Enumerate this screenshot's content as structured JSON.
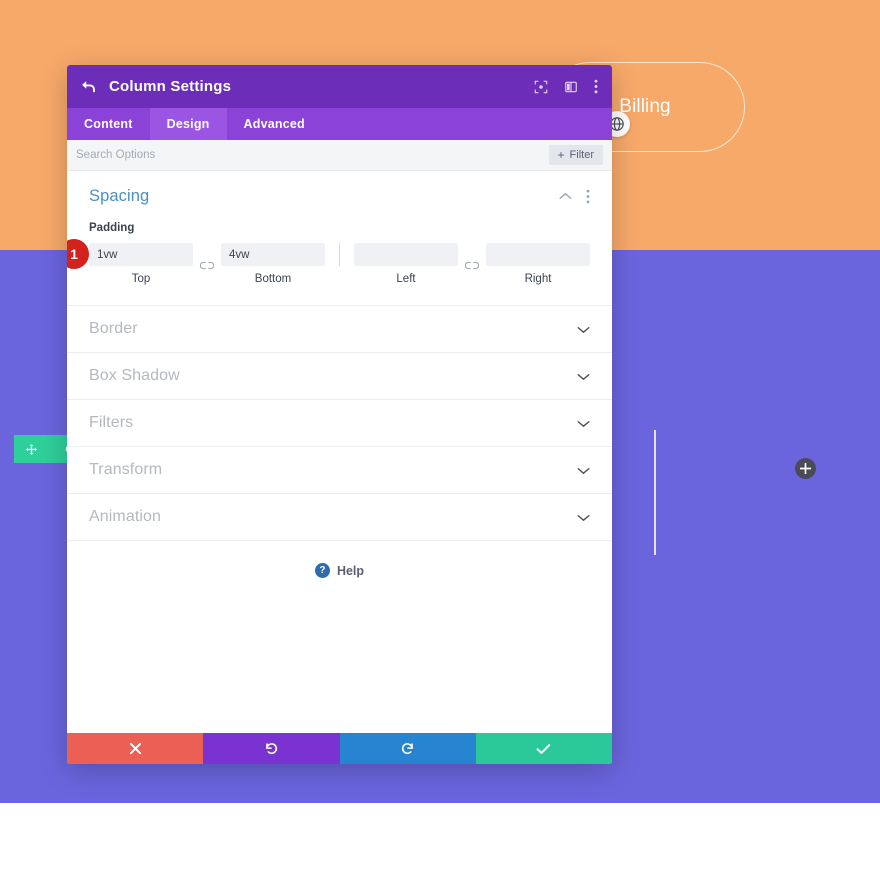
{
  "page_background": {
    "hero_color": "#f7a96a",
    "band_color": "#6a65dd",
    "bottom_color": "#ffffff",
    "hero_pill_label": "Billing",
    "hero_badge_icon": "globe-icon",
    "add_module_icon": "plus-icon",
    "module_toolbar": {
      "move_icon": "move-icon",
      "settings_icon": "gear-icon"
    }
  },
  "modal": {
    "header": {
      "back_icon": "back-arrow-icon",
      "title": "Column Settings",
      "icons": [
        {
          "name": "fullscreen-icon"
        },
        {
          "name": "split-view-icon"
        },
        {
          "name": "more-options-icon"
        }
      ]
    },
    "tabs": [
      {
        "label": "Content",
        "active": false
      },
      {
        "label": "Design",
        "active": true
      },
      {
        "label": "Advanced",
        "active": false
      }
    ],
    "search": {
      "value": "",
      "placeholder": "Search Options"
    },
    "filter_button": {
      "label": "Filter",
      "plus": "+"
    },
    "spacing": {
      "title": "Spacing",
      "collapse_icon": "chevron-up-icon",
      "options_icon": "more-options-icon",
      "padding_label": "Padding",
      "badge": "1",
      "link_icon": "broken-link-icon",
      "fields": [
        {
          "caption": "Top",
          "value": "1vw",
          "placeholder": ""
        },
        {
          "caption": "Bottom",
          "value": "4vw",
          "placeholder": ""
        },
        {
          "caption": "Left",
          "value": "",
          "placeholder": ""
        },
        {
          "caption": "Right",
          "value": "",
          "placeholder": ""
        }
      ]
    },
    "sections": [
      {
        "label": "Border",
        "chevron": "chevron-down-icon"
      },
      {
        "label": "Box Shadow",
        "chevron": "chevron-down-icon"
      },
      {
        "label": "Filters",
        "chevron": "chevron-down-icon"
      },
      {
        "label": "Transform",
        "chevron": "chevron-down-icon"
      },
      {
        "label": "Animation",
        "chevron": "chevron-down-icon"
      }
    ],
    "help": {
      "icon": "question-mark-icon",
      "label": "Help"
    },
    "footer": [
      {
        "name": "cancel",
        "icon": "close-icon",
        "color": "#ec5f55"
      },
      {
        "name": "undo",
        "icon": "undo-icon",
        "color": "#7a32d1"
      },
      {
        "name": "redo",
        "icon": "redo-icon",
        "color": "#2684d0"
      },
      {
        "name": "save",
        "icon": "check-icon",
        "color": "#2bc999"
      }
    ]
  }
}
